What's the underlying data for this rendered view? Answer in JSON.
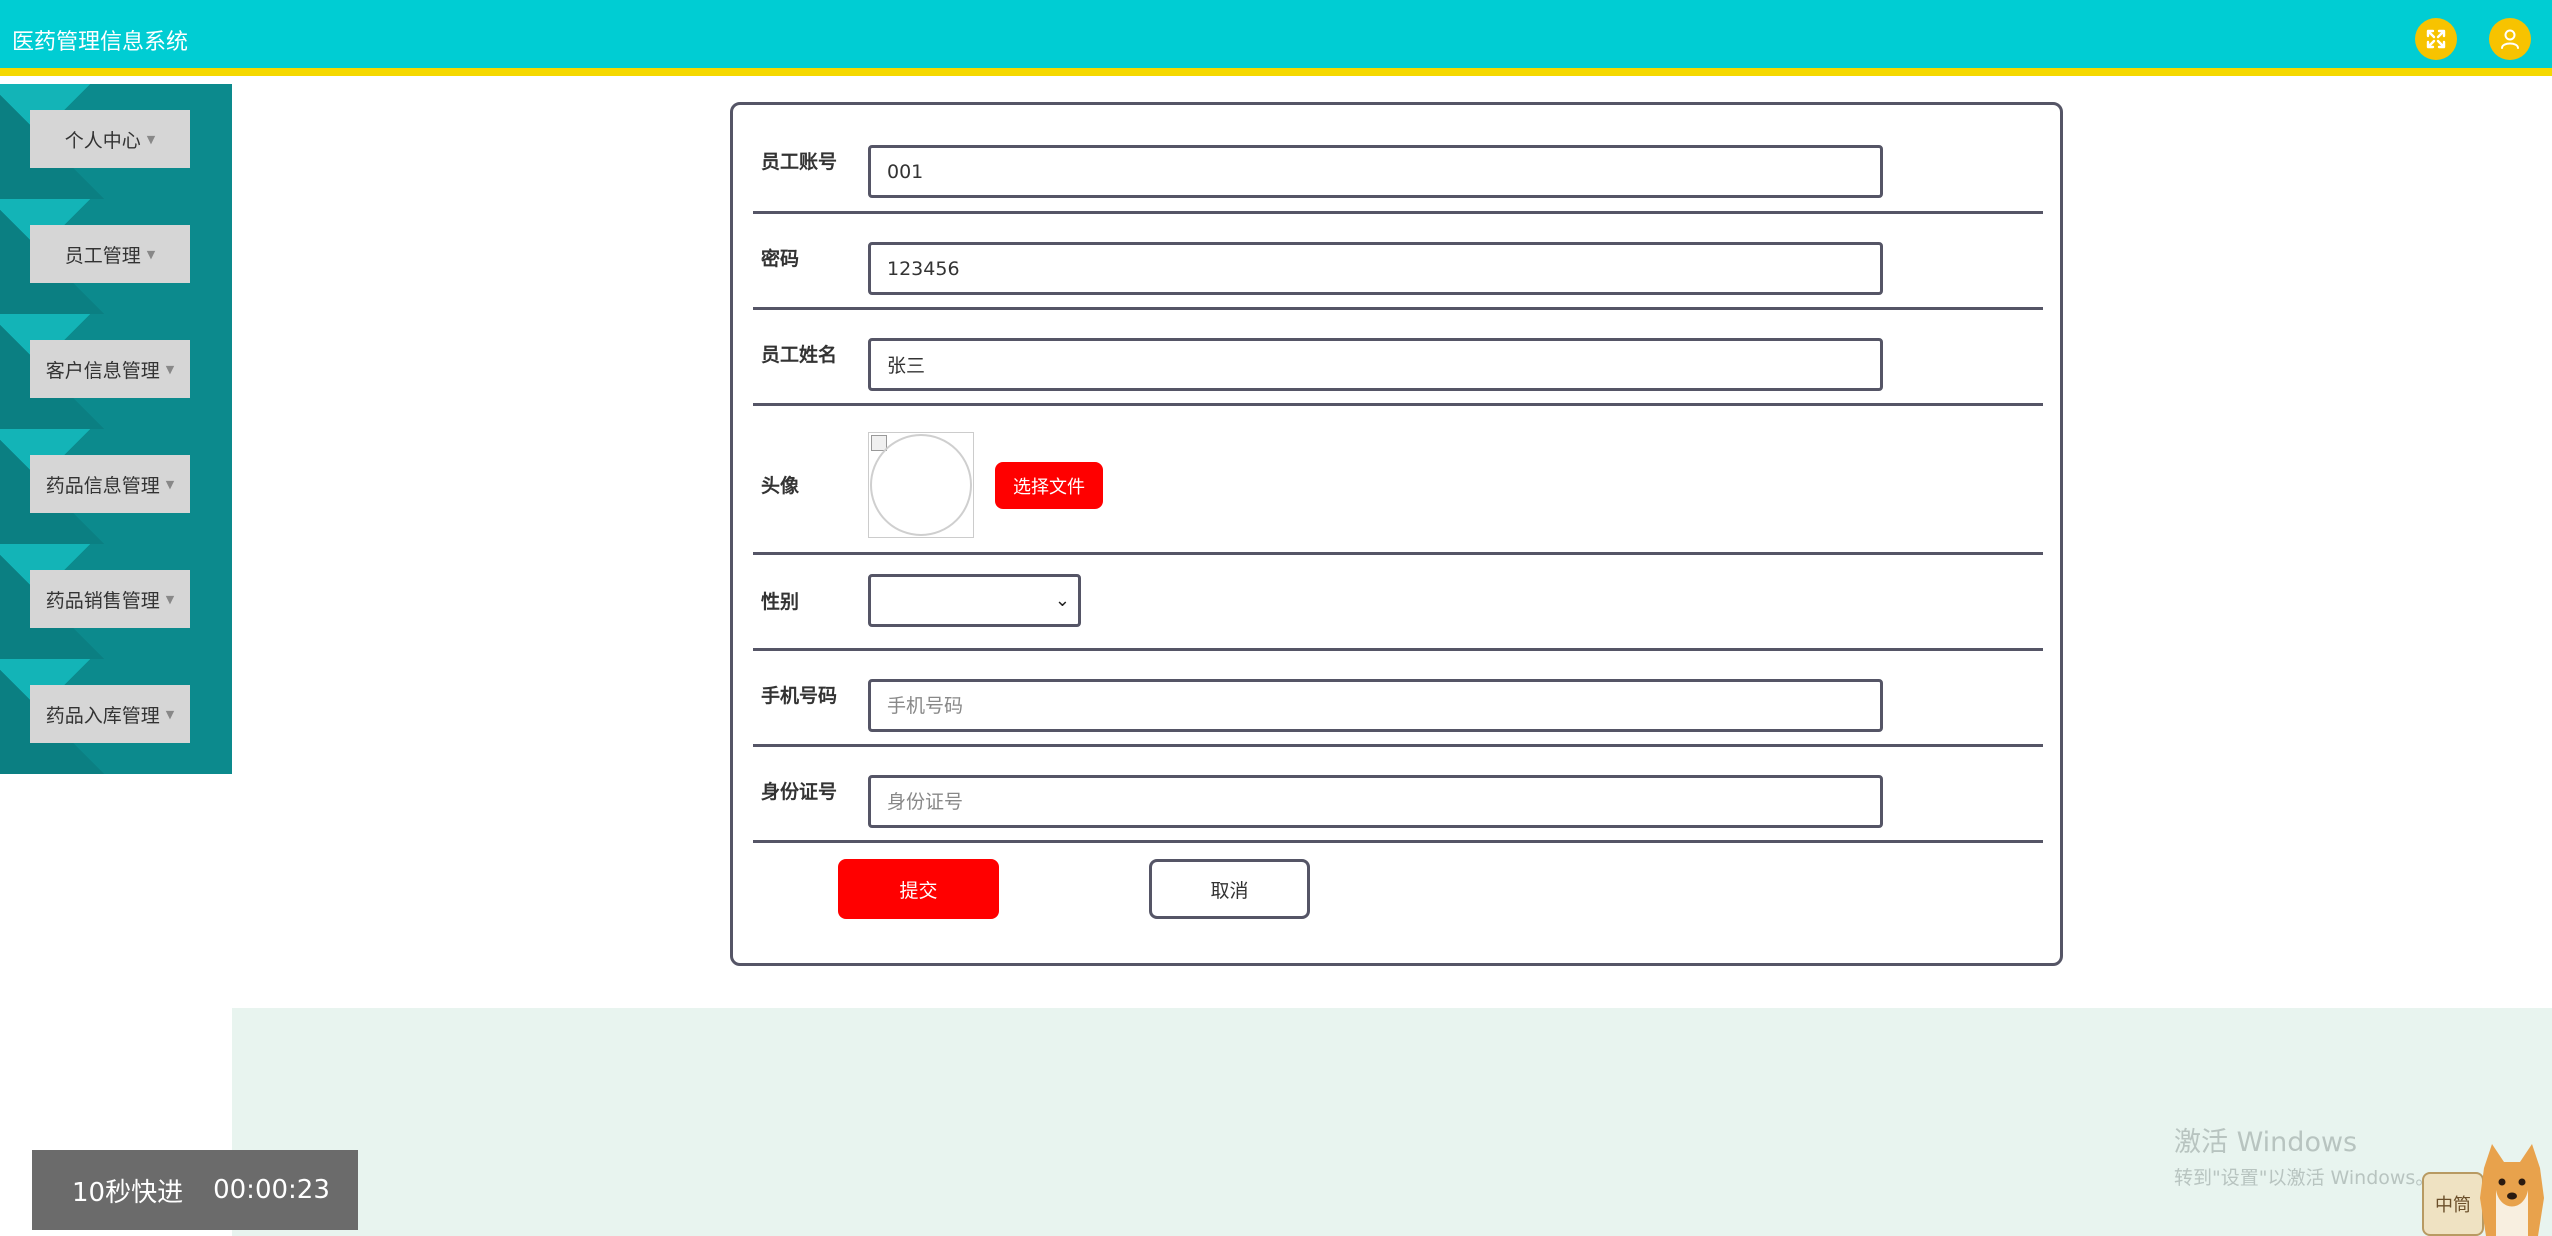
{
  "header": {
    "title": "医药管理信息系统",
    "fullscreen_icon": "fullscreen-icon",
    "user_icon": "user-icon"
  },
  "sidebar": {
    "items": [
      {
        "label": "个人中心"
      },
      {
        "label": "员工管理"
      },
      {
        "label": "客户信息管理"
      },
      {
        "label": "药品信息管理"
      },
      {
        "label": "药品销售管理"
      },
      {
        "label": "药品入库管理"
      }
    ]
  },
  "form": {
    "account": {
      "label": "员工账号",
      "value": "001"
    },
    "password": {
      "label": "密码",
      "value": "123456"
    },
    "name": {
      "label": "员工姓名",
      "value": "张三"
    },
    "avatar": {
      "label": "头像",
      "choose_button": "选择文件"
    },
    "gender": {
      "label": "性别",
      "value": ""
    },
    "phone": {
      "label": "手机号码",
      "placeholder": "手机号码"
    },
    "id_card": {
      "label": "身份证号",
      "placeholder": "身份证号"
    },
    "submit": "提交",
    "cancel": "取消"
  },
  "overlay": {
    "speed_text": "10秒快进",
    "time": "00:00:23",
    "windows_line1": "激活 Windows",
    "windows_line2": "转到\"设置\"以激活 Windows。",
    "pet_sign": "中筒"
  },
  "colors": {
    "header_bg": "#00cdd3",
    "header_border": "#f5d800",
    "accent_red": "#ff0000",
    "icon_yellow": "#f7c300"
  }
}
